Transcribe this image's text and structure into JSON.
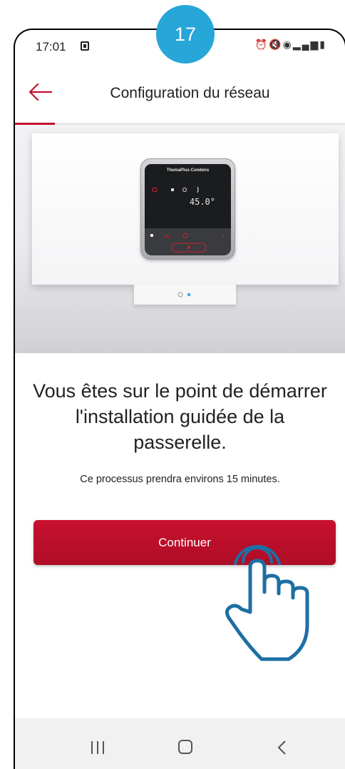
{
  "step_badge": "17",
  "status_bar": {
    "time": "17:01",
    "icons": [
      "alarm-icon",
      "mute-icon",
      "wifi-icon",
      "signal-icon",
      "battery-icon"
    ]
  },
  "app_bar": {
    "title": "Configuration du réseau",
    "back_icon": "arrow-left-icon"
  },
  "progress": {
    "fraction": 0.12,
    "color": "#c5112e"
  },
  "hero": {
    "device_brand": "ThemaPlus Condens",
    "device_display_temp": "45.0°"
  },
  "content": {
    "intro": "Vous êtes sur le point de démarrer l'installation guidée de la passerelle.",
    "note": "Ce processus prendra environs 15 minutes."
  },
  "continue_button": {
    "label": "Continuer",
    "color": "#c8102e"
  },
  "nav_bar": {
    "icons": [
      "recent-apps-icon",
      "home-icon",
      "back-icon"
    ]
  },
  "colors": {
    "accent": "#c5112e",
    "badge": "#27a6d8",
    "hand_outline": "#1d6fa3"
  }
}
